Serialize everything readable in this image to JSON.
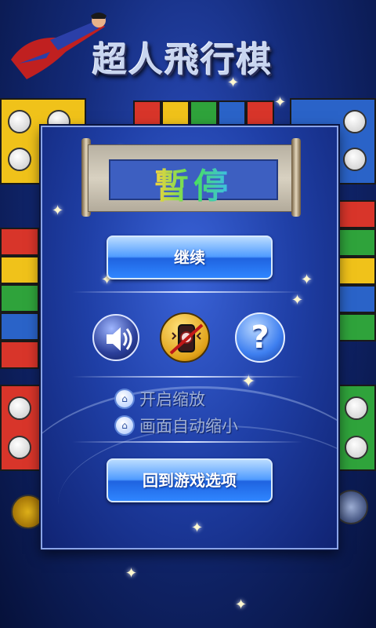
{
  "game_title": "超人飛行棋",
  "pause_dialog": {
    "title": "暫停",
    "resume_label": "继续",
    "icons": {
      "sound": "speaker-icon",
      "vibrate": "vibrate-phone-icon",
      "help": "question-mark-icon"
    },
    "help_glyph": "?",
    "options": [
      {
        "label": "开启缩放",
        "icon": "option-toggle-icon"
      },
      {
        "label": "画面自动缩小",
        "icon": "option-toggle-icon"
      }
    ],
    "back_label": "回到游戏选项"
  },
  "colors": {
    "red": "#d8352a",
    "yellow": "#f0c21a",
    "green": "#2fa33b",
    "blue": "#2a63c8",
    "dialog": "#1f3fa6"
  }
}
